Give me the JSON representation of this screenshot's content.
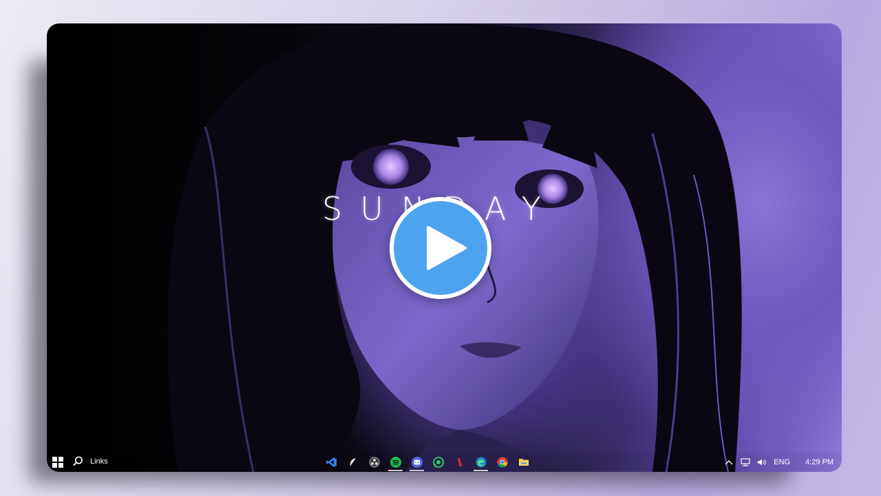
{
  "desktop": {
    "wallpaper_title": "SUNDAY",
    "play_button": "play-icon"
  },
  "taskbar": {
    "search_label": "Links",
    "apps": [
      {
        "name": "vscode-icon",
        "active": false
      },
      {
        "name": "app-icon",
        "active": false
      },
      {
        "name": "obs-icon",
        "active": false
      },
      {
        "name": "spotify-icon",
        "active": true
      },
      {
        "name": "discord-icon",
        "active": true
      },
      {
        "name": "whatsapp-icon",
        "active": false
      },
      {
        "name": "app-red-icon",
        "active": false
      },
      {
        "name": "edge-icon",
        "active": true
      },
      {
        "name": "chrome-icon",
        "active": false
      },
      {
        "name": "file-explorer-icon",
        "active": false
      }
    ],
    "tray": {
      "language": "ENG",
      "time": "4:29 PM"
    }
  },
  "colors": {
    "accent": "#4da3ee",
    "spotify": "#1db954",
    "discord": "#5865f2",
    "whatsapp": "#25d366",
    "vscode": "#2f80ed",
    "folder": "#f2c744"
  }
}
